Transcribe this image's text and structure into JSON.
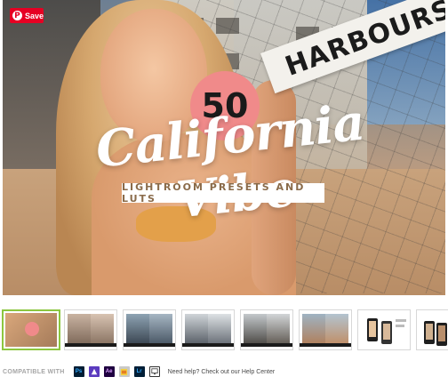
{
  "pin": {
    "save_label": "Save",
    "icon": "pinterest-icon"
  },
  "hero": {
    "sign_text": "HARBOURS",
    "badge_number": "50",
    "title": "California Vibe",
    "subtitle": "LIGHTROOM PRESETS AND LUTS"
  },
  "thumbnails": [
    {
      "kind": "cover",
      "selected": true
    },
    {
      "kind": "before-after"
    },
    {
      "kind": "before-after"
    },
    {
      "kind": "before-after"
    },
    {
      "kind": "before-after"
    },
    {
      "kind": "before-after"
    },
    {
      "kind": "phone-app"
    },
    {
      "kind": "phone-app"
    }
  ],
  "footer": {
    "compatible_label": "COMPATIBLE WITH",
    "apps": [
      {
        "label": "Ps",
        "icon": "photoshop-icon",
        "color": "#001d34",
        "fg": "#31a8ff"
      },
      {
        "label": "",
        "icon": "affinity-icon",
        "color": "#5b3bbf",
        "fg": "#ffffff"
      },
      {
        "label": "Ae",
        "icon": "after-effects-icon",
        "color": "#1f0040",
        "fg": "#d8a1ff"
      },
      {
        "label": "",
        "icon": "final-cut-icon",
        "color": "#c9c9c9",
        "fg": "#333333"
      },
      {
        "label": "Lr",
        "icon": "lightroom-icon",
        "color": "#001e36",
        "fg": "#31a8ff"
      },
      {
        "label": "",
        "icon": "monitor-icon",
        "color": "#ffffff",
        "fg": "#333333"
      }
    ],
    "help_text": "Need help? Check out our Help Center"
  }
}
